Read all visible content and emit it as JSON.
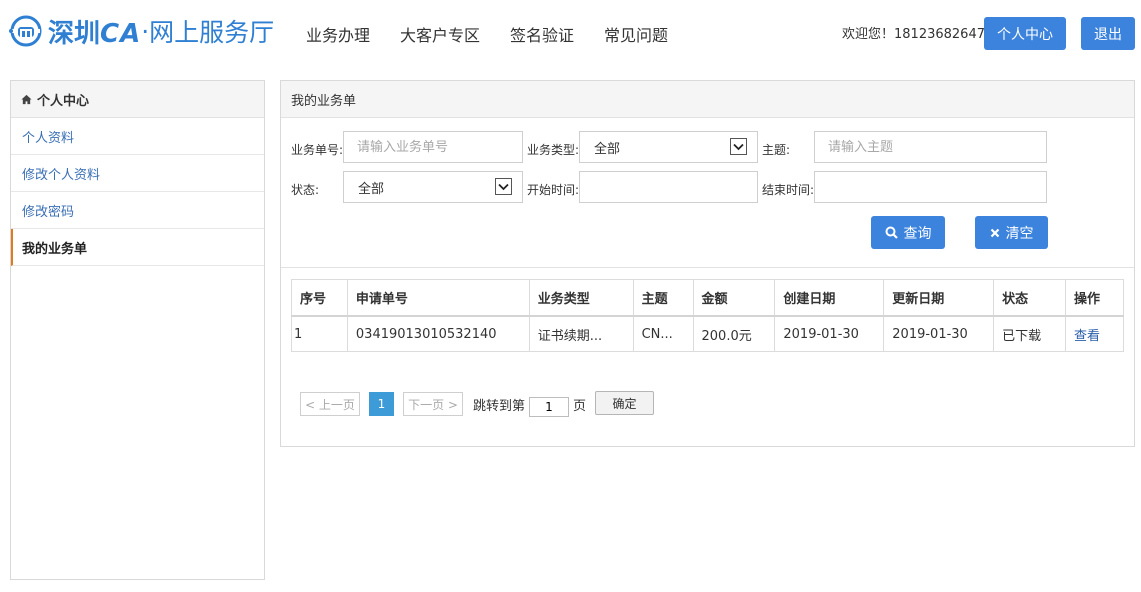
{
  "header": {
    "logo_brand": "深圳",
    "logo_ca": "CA",
    "logo_dot": "·",
    "logo_sub": "网上服务厅",
    "nav": [
      "业务办理",
      "大客户专区",
      "签名验证",
      "常见问题"
    ],
    "welcome": "欢迎您！18123682647",
    "center_btn": "个人中心",
    "logout_btn": "退出"
  },
  "sidebar": {
    "title": "个人中心",
    "items": [
      {
        "label": "个人资料",
        "active": false
      },
      {
        "label": "修改个人资料",
        "active": false
      },
      {
        "label": "修改密码",
        "active": false
      },
      {
        "label": "我的业务单",
        "active": true
      }
    ]
  },
  "main": {
    "title": "我的业务单",
    "filters": {
      "order_no_label": "业务单号:",
      "order_no_placeholder": "请输入业务单号",
      "type_label": "业务类型:",
      "type_value": "全部",
      "subject_label": "主题:",
      "subject_placeholder": "请输入主题",
      "status_label": "状态:",
      "status_value": "全部",
      "start_label": "开始时间:",
      "end_label": "结束时间:"
    },
    "search_btn": "查询",
    "clear_btn": "清空"
  },
  "table": {
    "headers": [
      "序号",
      "申请单号",
      "业务类型",
      "主题",
      "金额",
      "创建日期",
      "更新日期",
      "状态",
      "操作"
    ],
    "rows": [
      [
        "1",
        "03419013010532140",
        "证书续期...",
        "CN...",
        "200.0元",
        "2019-01-30",
        "2019-01-30",
        "已下载",
        "查看"
      ]
    ]
  },
  "pagination": {
    "prev": "< 上一页",
    "current": "1",
    "next": "下一页 >",
    "jump_label": "跳转到第",
    "jump_value": "1",
    "page_unit": "页",
    "confirm": "确定"
  },
  "colors": {
    "accent": "#3b83dd",
    "logo": "#2f7fd3",
    "active_marker": "#e07a1f",
    "page_current": "#3d9bd8"
  }
}
